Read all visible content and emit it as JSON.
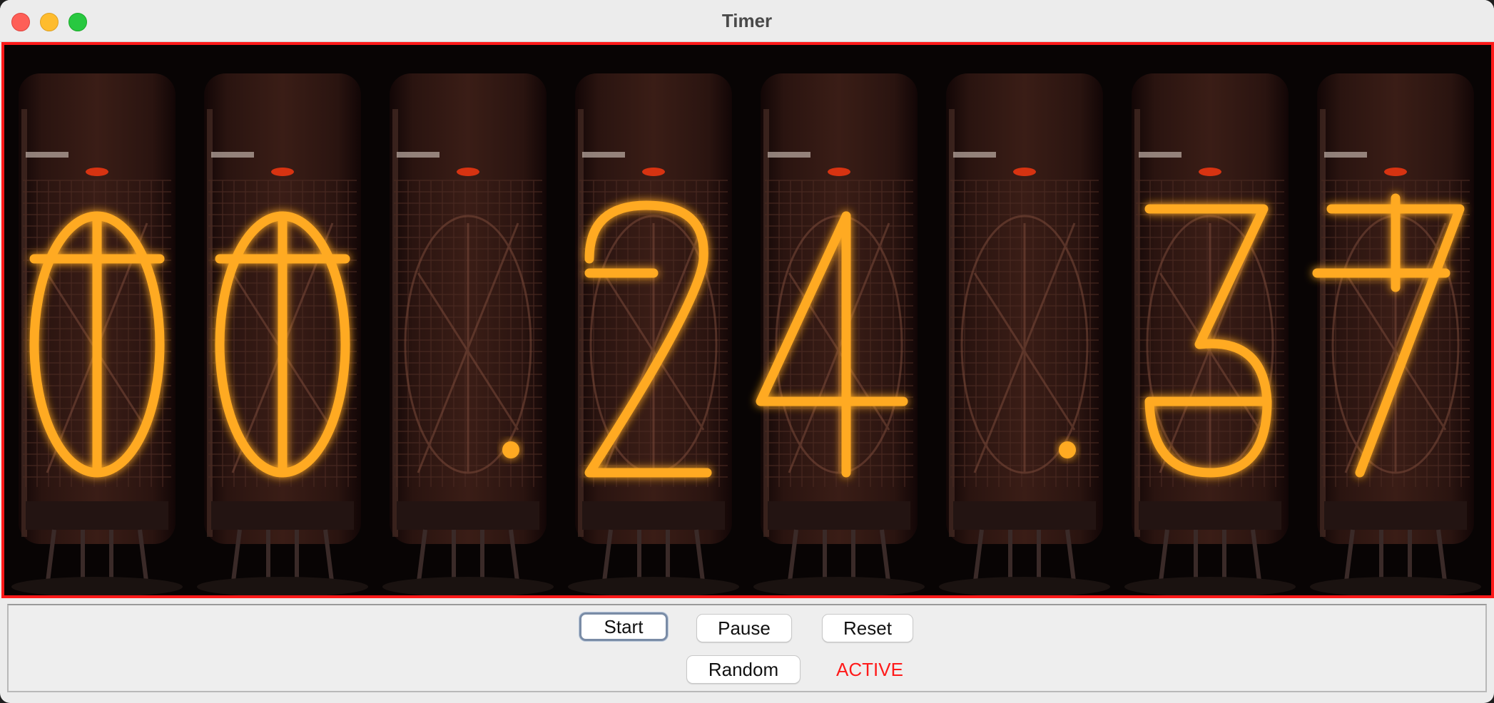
{
  "window": {
    "title": "Timer"
  },
  "display": {
    "digits": [
      "0",
      "0",
      "",
      "2",
      "4",
      "",
      "3",
      "7"
    ],
    "separator_dots": [
      false,
      false,
      true,
      false,
      false,
      true,
      false,
      false
    ],
    "glow_color": "#ffaa22",
    "frame_color": "#ff1a1a"
  },
  "controls": {
    "start_label": "Start",
    "pause_label": "Pause",
    "reset_label": "Reset",
    "random_label": "Random",
    "status_text": "ACTIVE",
    "status_color": "#ff1a1a"
  }
}
